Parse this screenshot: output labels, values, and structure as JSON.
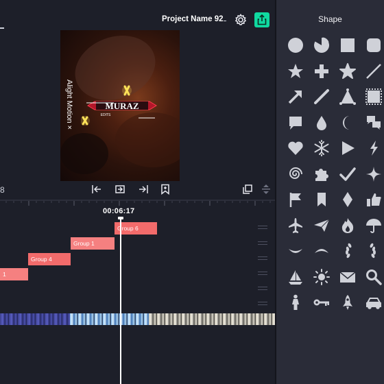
{
  "header": {
    "project_title": "Project Name 92",
    "settings_icon": "gear-icon",
    "export_icon": "share-upload-icon",
    "export_color": "#10d9a0"
  },
  "preview": {
    "watermark": "Alight Motion ×",
    "logo_text": "MURAZ",
    "logo_subtext": "EDITS"
  },
  "timeline": {
    "left_time": "8",
    "playhead_time": "00:06:17",
    "controls": [
      "jump-to-start-icon",
      "loop-icon",
      "jump-to-end-icon",
      "bookmark-icon",
      "copy-icon",
      "zoom-toggle-icon"
    ],
    "clips": [
      {
        "label": "Group 6",
        "color": "#f26b6b"
      },
      {
        "label": "Group 1",
        "color": "#f58080"
      },
      {
        "label": "Group 4",
        "color": "#f26b6b"
      },
      {
        "label": "1",
        "color": "#f58080"
      }
    ]
  },
  "shape_panel": {
    "title": "Shape",
    "shapes": [
      "circle",
      "pie",
      "square",
      "rounded-square",
      "star",
      "plus",
      "star-rounded",
      "line",
      "arrow",
      "pencil-line",
      "triangle-tent",
      "stamp-square",
      "speech-bubble",
      "drop",
      "crescent",
      "chat-bubbles",
      "heart",
      "snowflake",
      "play-triangle",
      "lightning",
      "spiral",
      "puzzle",
      "check",
      "sparkle-star",
      "flag",
      "bookmark",
      "diamond",
      "thumbs-up",
      "airplane",
      "paper-plane",
      "flame",
      "umbrella",
      "smile-curve",
      "frown-curve",
      "laurel-left",
      "laurel-right",
      "sailboat",
      "sun",
      "envelope",
      "magnifier",
      "person",
      "key",
      "rocket",
      "car"
    ],
    "shape_color": "#cfd1d8"
  }
}
